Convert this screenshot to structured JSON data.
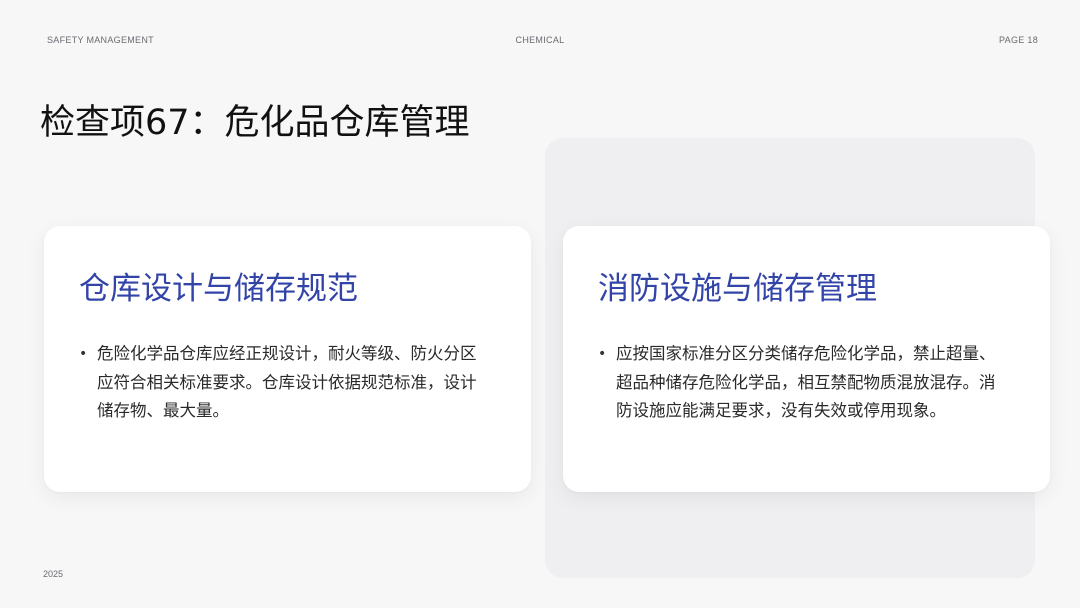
{
  "header": {
    "left": "SAFETY MANAGEMENT",
    "center": "CHEMICAL",
    "right": "PAGE 18"
  },
  "title": "检查项67：危化品仓库管理",
  "cards": [
    {
      "title": "仓库设计与储存规范",
      "bullet": "•",
      "text": "危险化学品仓库应经正规设计，耐火等级、防火分区应符合相关标准要求。仓库设计依据规范标准，设计储存物、最大量。"
    },
    {
      "title": "消防设施与储存管理",
      "bullet": "•",
      "text": "应按国家标准分区分类储存危险化学品，禁止超量、超品种储存危险化学品，相互禁配物质混放混存。消防设施应能满足要求，没有失效或停用现象。"
    }
  ],
  "footer": {
    "year": "2025"
  }
}
